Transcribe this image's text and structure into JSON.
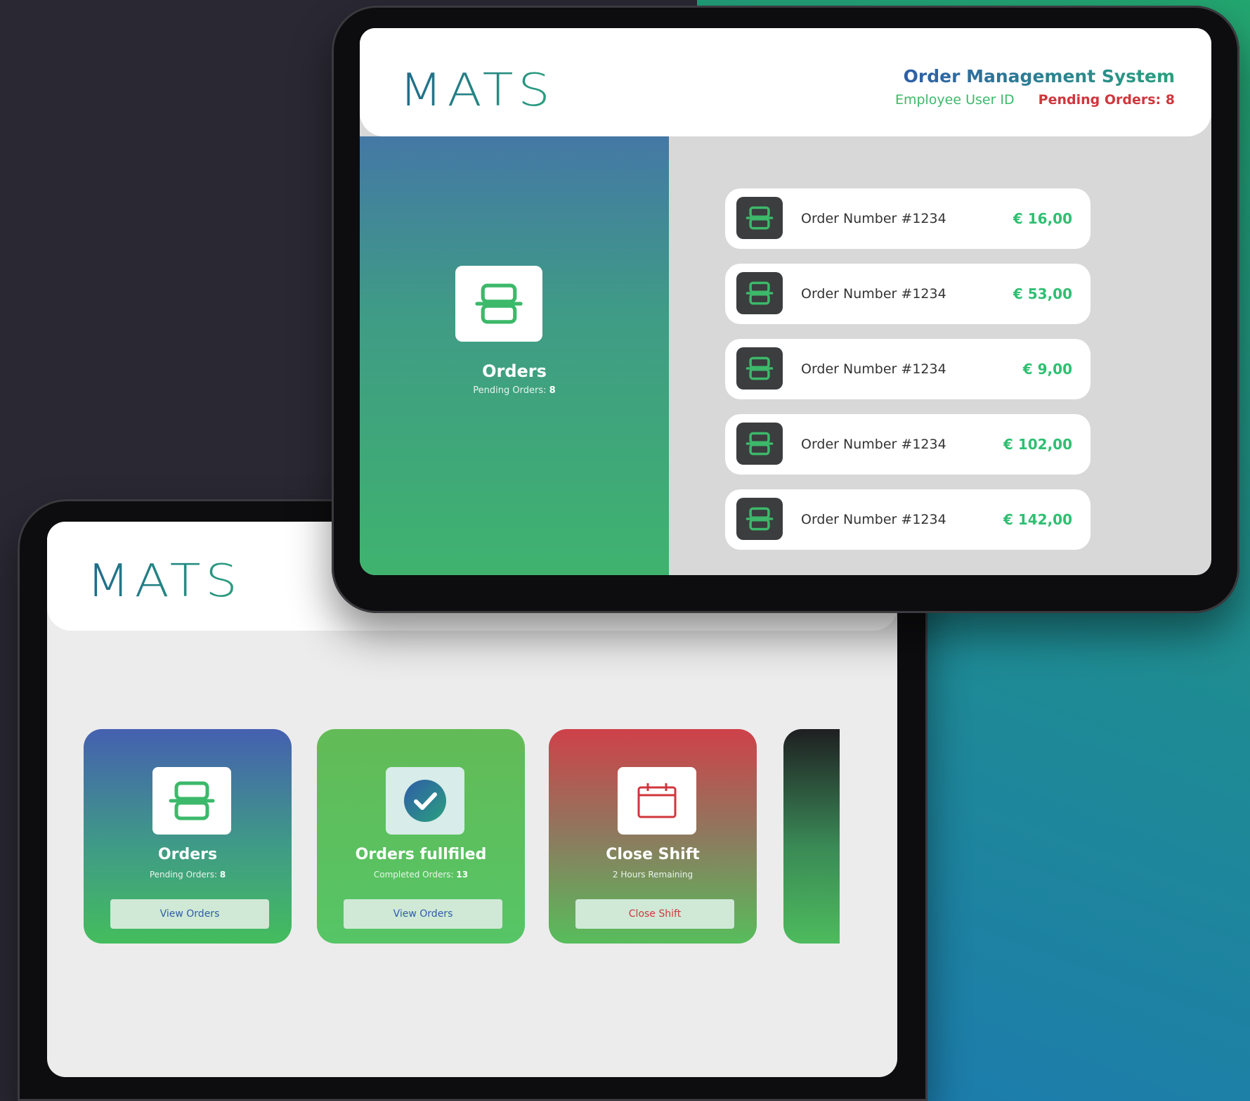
{
  "colors": {
    "brand_green": "#2fbf72",
    "brand_blue": "#2f5ca8",
    "alert_red": "#d0363d"
  },
  "front_screen": {
    "logo": "MATS",
    "system_title": "Order Management System",
    "employee_label": "Employee User ID",
    "pending_header": "Pending Orders: 8",
    "panel": {
      "icon": "box-icon",
      "title": "Orders",
      "pending_label": "Pending Orders:",
      "pending_count": "8"
    },
    "orders": [
      {
        "number": "Order Number #1234",
        "price": "€ 16,00",
        "icon": "box-icon"
      },
      {
        "number": "Order Number #1234",
        "price": "€ 53,00",
        "icon": "box-icon"
      },
      {
        "number": "Order Number #1234",
        "price": "€ 9,00",
        "icon": "box-icon"
      },
      {
        "number": "Order Number #1234",
        "price": "€ 102,00",
        "icon": "box-icon"
      },
      {
        "number": "Order Number #1234",
        "price": "€ 142,00",
        "icon": "box-icon"
      }
    ]
  },
  "back_screen": {
    "logo": "MATS",
    "cards": [
      {
        "title": "Orders",
        "sub_label": "Pending Orders:",
        "sub_value": "8",
        "button": "View Orders",
        "icon": "box-icon",
        "button_color": "#2f5ca8"
      },
      {
        "title": "Orders fullfiled",
        "sub_label": "Completed Orders:",
        "sub_value": "13",
        "button": "View Orders",
        "icon": "check-circle-icon",
        "button_color": "#2f5ca8"
      },
      {
        "title": "Close Shift",
        "sub_label": "2 Hours Remaining",
        "sub_value": "",
        "button": "Close Shift",
        "icon": "calendar-icon",
        "button_color": "#d0363d"
      }
    ]
  }
}
